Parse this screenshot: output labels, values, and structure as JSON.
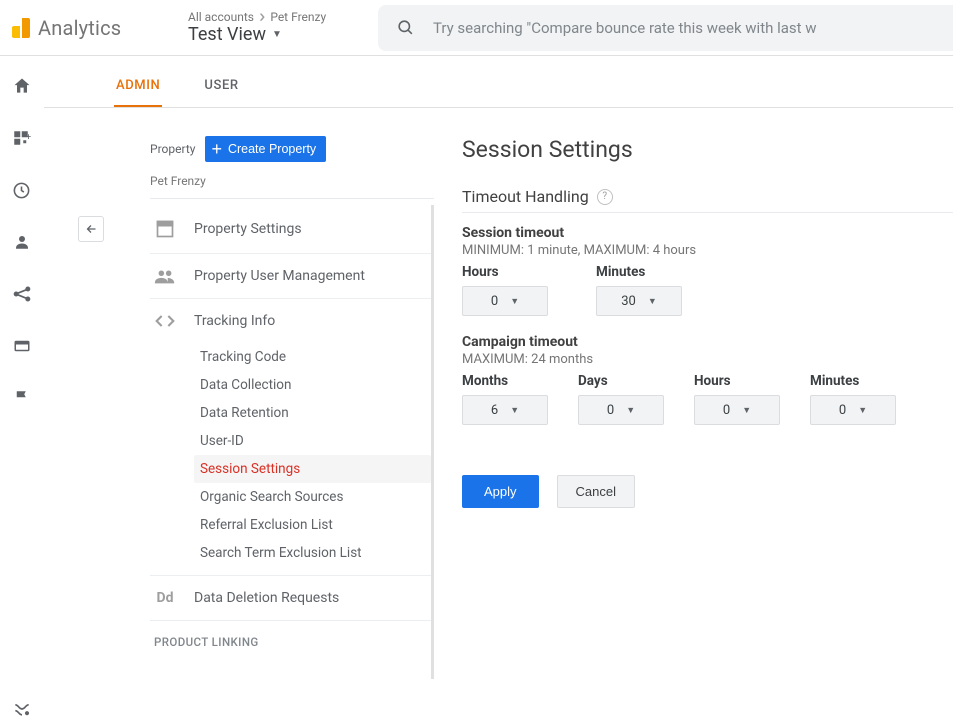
{
  "header": {
    "product": "Analytics",
    "breadcrumb_all": "All accounts",
    "breadcrumb_account": "Pet Frenzy",
    "view_name": "Test View",
    "search_placeholder": "Try searching \"Compare bounce rate this week with last w"
  },
  "tabs": {
    "admin": "ADMIN",
    "user": "USER"
  },
  "midcol": {
    "property_label": "Property",
    "create_property": "Create Property",
    "account_name": "Pet Frenzy",
    "items": {
      "property_settings": "Property Settings",
      "user_mgmt": "Property User Management",
      "tracking_info": "Tracking Info",
      "data_deletion": "Data Deletion Requests"
    },
    "tracking_sub": [
      "Tracking Code",
      "Data Collection",
      "Data Retention",
      "User-ID",
      "Session Settings",
      "Organic Search Sources",
      "Referral Exclusion List",
      "Search Term Exclusion List"
    ],
    "product_linking": "PRODUCT LINKING"
  },
  "panel": {
    "title": "Session Settings",
    "section": "Timeout Handling",
    "session": {
      "title": "Session timeout",
      "hint": "MINIMUM: 1 minute, MAXIMUM: 4 hours",
      "hours_label": "Hours",
      "minutes_label": "Minutes",
      "hours": "0",
      "minutes": "30"
    },
    "campaign": {
      "title": "Campaign timeout",
      "hint": "MAXIMUM: 24 months",
      "months_label": "Months",
      "days_label": "Days",
      "hours_label": "Hours",
      "minutes_label": "Minutes",
      "months": "6",
      "days": "0",
      "hours": "0",
      "minutes": "0"
    },
    "apply": "Apply",
    "cancel": "Cancel"
  }
}
